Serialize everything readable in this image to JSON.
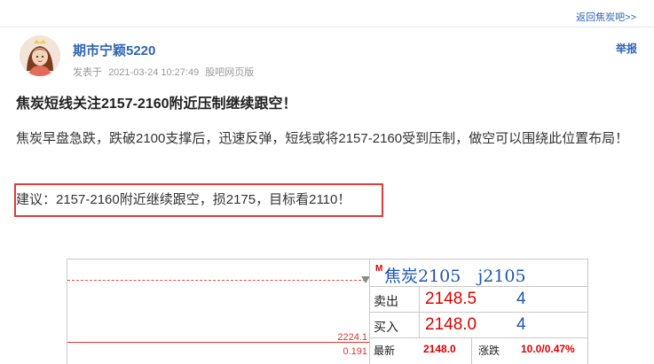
{
  "topbar": {
    "back_link": "返回焦炭吧>>"
  },
  "post": {
    "author": "期市宁颖5220",
    "meta_prefix": "发表于",
    "timestamp": "2021-03-24 10:27:49",
    "source": "股吧网页版",
    "report": "举报",
    "title": "焦炭短线关注2157-2160附近压制继续跟空！",
    "body": "焦炭早盘急跌，跌破2100支撑后，迅速反弹，短线或将2157-2160受到压制，做空可以围绕此位置布局！",
    "suggestion": "建议：2157-2160附近继续跟空，损2175，目标看2110！"
  },
  "quote": {
    "marker": "M",
    "name": "焦炭2105　j2105",
    "chart_price": "2224.1",
    "chart_pct": "0.191",
    "rows": [
      {
        "label": "卖出",
        "price": "2148.5",
        "volume": "4"
      },
      {
        "label": "买入",
        "price": "2148.0",
        "volume": "4"
      }
    ],
    "last_label": "最新",
    "last_value": "2148.0",
    "change_label": "涨跌",
    "change_value": "10.0/0.47%"
  },
  "colors": {
    "link_blue": "#2d64b3",
    "alert_red": "#e03a3a",
    "price_red": "#dd0000"
  },
  "icons": {
    "avatar": "user-avatar",
    "arrow": "triangle-down-icon"
  }
}
